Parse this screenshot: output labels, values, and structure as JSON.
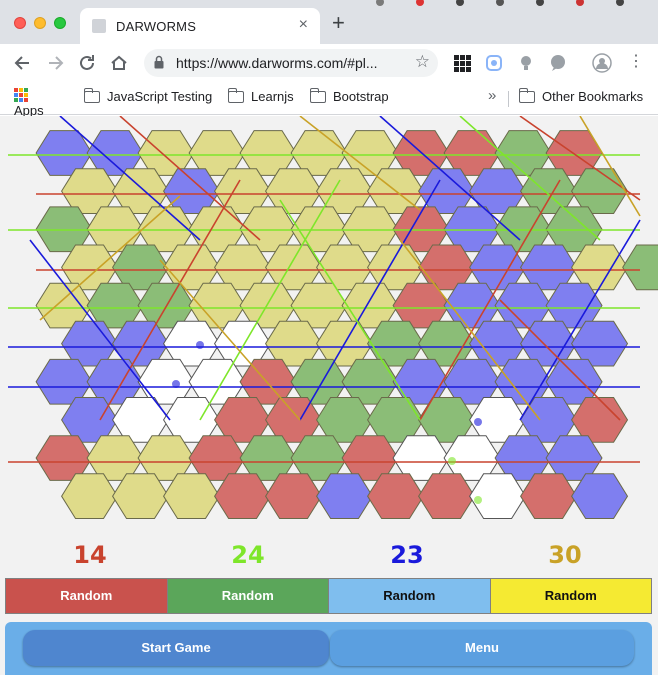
{
  "browser": {
    "tab_title": "DARWORMS",
    "tab_close": "×",
    "new_tab": "+",
    "url": "https://www.darworms.com/#pl...",
    "back_icon": "arrow-left-icon",
    "forward_icon": "arrow-right-icon",
    "reload_icon": "reload-icon",
    "home_icon": "home-icon",
    "bookmarks": [
      {
        "label": "Apps",
        "icon": "apps-grid-icon"
      },
      {
        "label": "JavaScript Testing",
        "icon": "folder-icon"
      },
      {
        "label": "Learnjs",
        "icon": "folder-icon"
      },
      {
        "label": "Bootstrap",
        "icon": "folder-icon"
      }
    ],
    "overflow": "»",
    "other_bookmarks": "Other Bookmarks"
  },
  "game": {
    "colors": {
      "red": "#c9432e",
      "green": "#7ee62a",
      "blue": "#1a1adb",
      "yellow": "#c9a227",
      "hex_red": "#d46f6c",
      "hex_green": "#8bbd77",
      "hex_blue": "#7f7ff0",
      "hex_yellow": "#dfdb8a",
      "hex_empty": "#ffffff"
    },
    "scores": [
      {
        "value": "14",
        "color": "#c9432e"
      },
      {
        "value": "24",
        "color": "#7ee62a"
      },
      {
        "value": "23",
        "color": "#1a1adb"
      },
      {
        "value": "30",
        "color": "#c9a227"
      }
    ],
    "players": [
      {
        "label": "Random",
        "bg": "#c9524d",
        "fg": "#ffffff"
      },
      {
        "label": "Random",
        "bg": "#5ba65a",
        "fg": "#ffffff"
      },
      {
        "label": "Random",
        "bg": "#7fbeee",
        "fg": "#111111"
      },
      {
        "label": "Random",
        "bg": "#f5ea32",
        "fg": "#111111"
      }
    ],
    "start_game": "Start Game",
    "menu": "Menu",
    "board_rows": [
      "BBYYYYYRRGR",
      "YYBYYYYBBGG",
      "GYYYYYYRBGG",
      "YGYYYYYRBBYG",
      "YGGYYYYRBBB",
      "BBWWYYGGBBB",
      "BBWWRGGBBBB",
      "BWWRRGGGWBR",
      "RYYRGGRWWBB",
      "YYYRRBRRWRB"
    ]
  }
}
